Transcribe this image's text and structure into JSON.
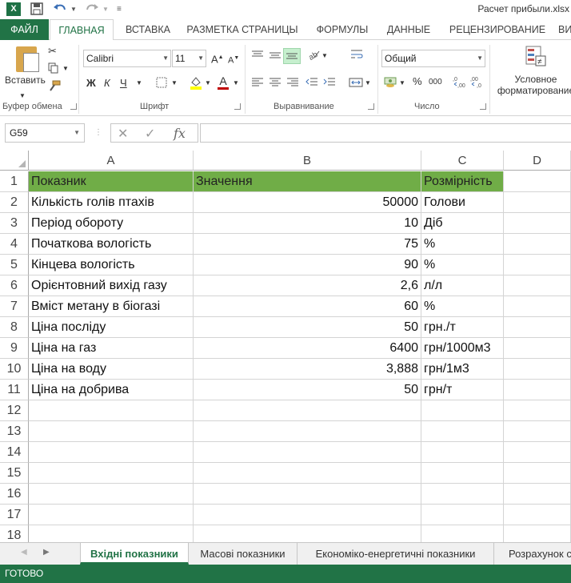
{
  "window": {
    "title": "Расчет прибыли.xlsx",
    "undo_icon": "undo-icon",
    "redo_icon": "redo-icon"
  },
  "ribbon_tabs": [
    "ФАЙЛ",
    "ГЛАВНАЯ",
    "ВСТАВКА",
    "РАЗМЕТКА СТРАНИЦЫ",
    "ФОРМУЛЫ",
    "ДАННЫЕ",
    "РЕЦЕНЗИРОВАНИЕ",
    "ВИ"
  ],
  "ribbon": {
    "clipboard": {
      "paste_label": "Вставить",
      "group_label": "Буфер обмена"
    },
    "font": {
      "font_name": "Calibri",
      "font_size": "11",
      "grow_label": "A",
      "shrink_label": "A",
      "bold": "Ж",
      "italic": "К",
      "underline": "Ч",
      "font_color_letter": "A",
      "group_label": "Шрифт"
    },
    "alignment": {
      "group_label": "Выравнивание"
    },
    "number": {
      "format": "Общий",
      "percent": "%",
      "thousands": "000",
      "group_label": "Число"
    },
    "styles": {
      "cond_format_line1": "Условное",
      "cond_format_line2": "форматирование"
    }
  },
  "formula_bar": {
    "name_box": "G59",
    "fx": "fx",
    "formula": ""
  },
  "columns": [
    "A",
    "B",
    "C",
    "D"
  ],
  "rows": [
    {
      "n": "1",
      "a": "Показник",
      "b": "Значення",
      "c": "Розмірність"
    },
    {
      "n": "2",
      "a": "Кількість голів птахів",
      "b": "50000",
      "c": "Голови"
    },
    {
      "n": "3",
      "a": "Період обороту",
      "b": "10",
      "c": "Діб"
    },
    {
      "n": "4",
      "a": "Початкова вологість",
      "b": "75",
      "c": "%"
    },
    {
      "n": "5",
      "a": "Кінцева вологість",
      "b": "90",
      "c": "%"
    },
    {
      "n": "6",
      "a": "Орієнтовний вихід газу",
      "b": "2,6",
      "c": "л/л"
    },
    {
      "n": "7",
      "a": "Вміст метану в біогазі",
      "b": "60",
      "c": "%"
    },
    {
      "n": "8",
      "a": "Ціна посліду",
      "b": "50",
      "c": "грн./т"
    },
    {
      "n": "9",
      "a": "Ціна на газ",
      "b": "6400",
      "c": "грн/1000м3"
    },
    {
      "n": "10",
      "a": "Ціна на воду",
      "b": "3,888",
      "c": "грн/1м3"
    },
    {
      "n": "11",
      "a": "Ціна на добрива",
      "b": "50",
      "c": "грн/т"
    },
    {
      "n": "12",
      "a": "",
      "b": "",
      "c": ""
    },
    {
      "n": "13",
      "a": "",
      "b": "",
      "c": ""
    },
    {
      "n": "14",
      "a": "",
      "b": "",
      "c": ""
    },
    {
      "n": "15",
      "a": "",
      "b": "",
      "c": ""
    },
    {
      "n": "16",
      "a": "",
      "b": "",
      "c": ""
    },
    {
      "n": "17",
      "a": "",
      "b": "",
      "c": ""
    },
    {
      "n": "18",
      "a": "",
      "b": "",
      "c": ""
    }
  ],
  "sheet_tabs": [
    "Вхідні показники",
    "Масові показники",
    "Економіко-енергетичні показники",
    "Розрахунок с"
  ],
  "active_sheet": "Вхідні показники",
  "status": "ГОТОВО",
  "colors": {
    "accent": "#217346",
    "header_fill": "#70ad47"
  }
}
